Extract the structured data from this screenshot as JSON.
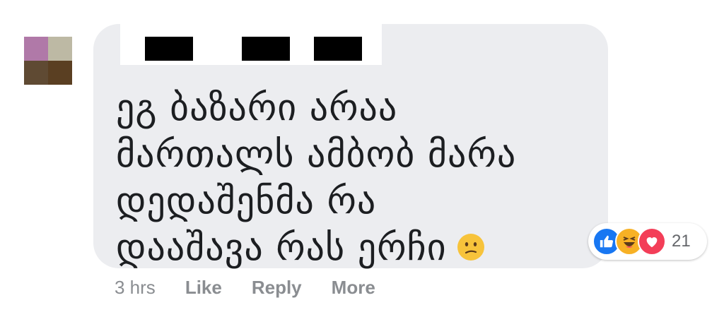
{
  "comment": {
    "lines": [
      "ეგ ბაზარი არაა",
      "მართალს ამბობ მარა",
      "დედაშენმა რა",
      "დააშავა რას ერჩი"
    ],
    "emoji": "confused-face"
  },
  "reactions": {
    "icons": [
      "like-icon",
      "haha-icon",
      "love-icon"
    ],
    "count": "21"
  },
  "actions": {
    "time": "3 hrs",
    "like": "Like",
    "reply": "Reply",
    "more": "More"
  },
  "colors": {
    "bubble": "#ecedf0",
    "like": "#1877f2",
    "haha": "#f7b125",
    "love": "#f33e58",
    "meta": "#8a8d91"
  }
}
